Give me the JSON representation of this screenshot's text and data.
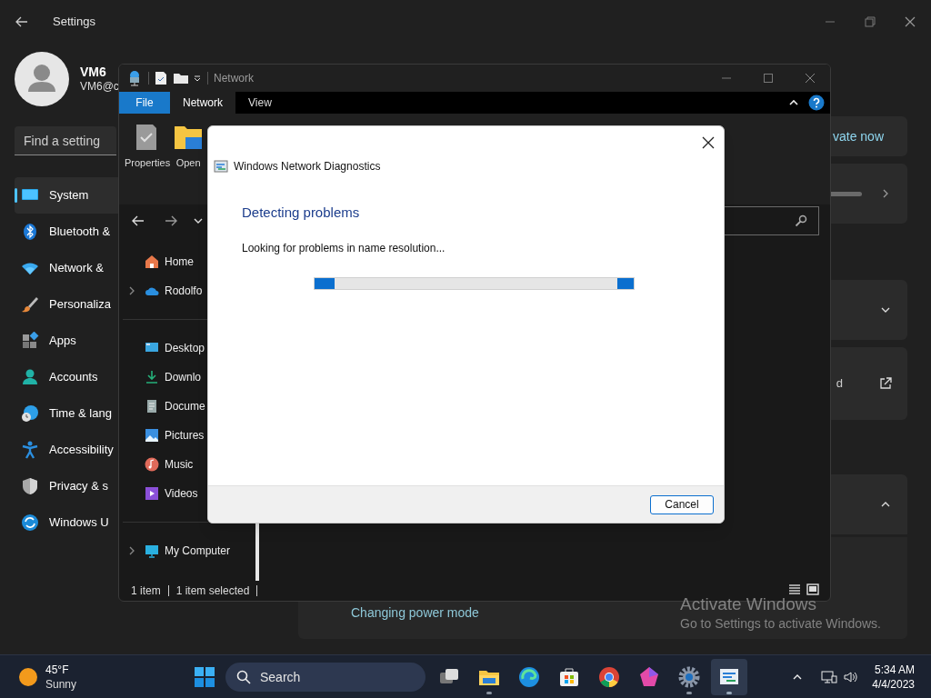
{
  "settings": {
    "title": "Settings",
    "user": {
      "name": "VM6",
      "email": "VM6@c"
    },
    "search": {
      "placeholder": "Find a setting"
    },
    "nav": [
      {
        "label": "System",
        "selected": true
      },
      {
        "label": "Bluetooth &",
        "selected": false
      },
      {
        "label": "Network &",
        "selected": false
      },
      {
        "label": "Personaliza",
        "selected": false
      },
      {
        "label": "Apps",
        "selected": false
      },
      {
        "label": "Accounts",
        "selected": false
      },
      {
        "label": "Time & lang",
        "selected": false
      },
      {
        "label": "Accessibility",
        "selected": false
      },
      {
        "label": "Privacy & s",
        "selected": false
      },
      {
        "label": "Windows U",
        "selected": false
      }
    ],
    "cards": [
      {
        "kind": "link",
        "text": "vate now"
      },
      {
        "kind": "slider"
      },
      {
        "kind": "expand"
      },
      {
        "kind": "external",
        "text": "d"
      },
      {
        "kind": "collapse"
      },
      {
        "kind": "status",
        "text": "Changing power mode"
      }
    ]
  },
  "explorer": {
    "title": "Network",
    "file_menu": "File",
    "tabs": [
      {
        "label": "Network",
        "selected": true
      },
      {
        "label": "View",
        "selected": false
      }
    ],
    "ribbon": [
      "Properties",
      "Open"
    ],
    "nav_pane": [
      {
        "label": "Home",
        "expandable": false
      },
      {
        "label": "Rodolfo",
        "expandable": true
      },
      {
        "label": "Desktop",
        "expandable": false
      },
      {
        "label": "Downlo",
        "expandable": false
      },
      {
        "label": "Docume",
        "expandable": false
      },
      {
        "label": "Pictures",
        "expandable": false
      },
      {
        "label": "Music",
        "expandable": false
      },
      {
        "label": "Videos",
        "expandable": false
      },
      {
        "label": "My Computer",
        "expandable": true
      }
    ],
    "status": [
      "1 item",
      "1 item selected"
    ]
  },
  "dialog": {
    "title": "Windows Network Diagnostics",
    "heading": "Detecting problems",
    "message": "Looking for problems in name resolution...",
    "progress": {
      "indeterminate": true
    },
    "button": "Cancel"
  },
  "activation_notice": {
    "title": "Activate Windows",
    "message": "Go to Settings to activate Windows."
  },
  "taskbar": {
    "weather": {
      "temperature": "45°F",
      "condition": "Sunny"
    },
    "search": "Search",
    "apps": [
      {
        "running": false,
        "active": false
      },
      {
        "running": true,
        "active": false
      },
      {
        "running": false,
        "active": false
      },
      {
        "running": false,
        "active": false
      },
      {
        "running": false,
        "active": false
      },
      {
        "running": false,
        "active": false
      },
      {
        "running": true,
        "active": false
      },
      {
        "running": true,
        "active": true
      }
    ],
    "time": "5:34 AM",
    "date": "4/4/2023"
  }
}
